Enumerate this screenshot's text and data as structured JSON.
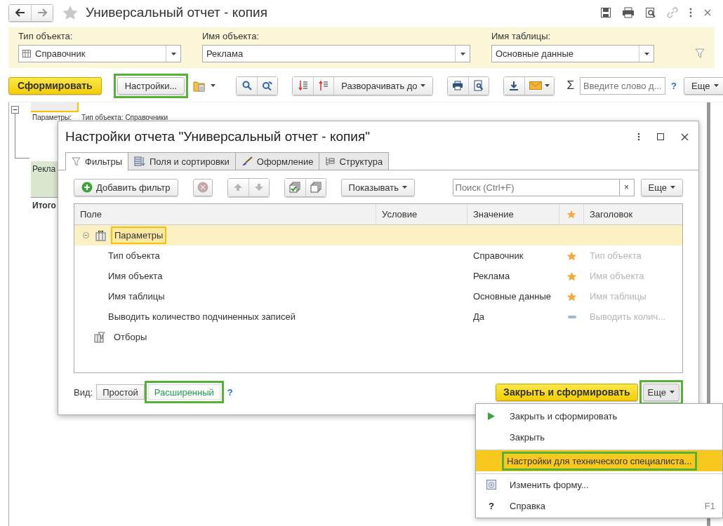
{
  "window": {
    "title": "Универсальный отчет - копия"
  },
  "params": [
    {
      "label": "Тип объекта:",
      "value": "Справочник",
      "kind": "type_select"
    },
    {
      "label": "Имя объекта:",
      "value": "Реклама",
      "kind": "select"
    },
    {
      "label": "Имя таблицы:",
      "value": "Основные данные",
      "kind": "select"
    }
  ],
  "toolbar": {
    "generate": "Сформировать",
    "settings": {
      "label": "Настройки...",
      "highlighted": true
    },
    "expand": "Разворачивать до",
    "sum": "Σ",
    "search_placeholder": "Введите слово д...",
    "help": "?",
    "more": "Еще"
  },
  "report": {
    "params_label": "Параметры:",
    "params_text": "Тип объекта: Справочники",
    "group_cell": "Рекла",
    "total": "Итого"
  },
  "dialog": {
    "title": "Настройки отчета \"Универсальный отчет - копия\"",
    "tabs": [
      {
        "label": "Фильтры",
        "selected": true
      },
      {
        "label": "Поля и сортировки",
        "selected": false
      },
      {
        "label": "Оформление",
        "selected": false
      },
      {
        "label": "Структура",
        "selected": false
      }
    ],
    "add_filter": "Добавить фильтр",
    "show": "Показывать",
    "search_placeholder": "Поиск (Ctrl+F)",
    "clear": "×",
    "more": "Еще",
    "columns": [
      "Поле",
      "Условие",
      "Значение",
      "Заголовок"
    ],
    "rows": [
      {
        "field": "Параметры",
        "kind": "group",
        "expanded": true,
        "selected": true,
        "children": [
          {
            "field": "Тип объекта",
            "value": "Справочник",
            "quick": true,
            "title": "Тип объекта"
          },
          {
            "field": "Имя объекта",
            "value": "Реклама",
            "quick": true,
            "title": "Имя объекта"
          },
          {
            "field": "Имя таблицы",
            "value": "Основные данные",
            "quick": true,
            "title": "Имя таблицы"
          },
          {
            "field": "Выводить количество подчиненных записей",
            "value": "Да",
            "quick": false,
            "title": "Выводить колич..."
          }
        ]
      },
      {
        "field": "Отборы",
        "kind": "filters",
        "selected": false
      }
    ],
    "view_label": "Вид:",
    "views": [
      {
        "label": "Простой",
        "selected": false,
        "highlighted": false
      },
      {
        "label": "Расширенный",
        "selected": true,
        "highlighted": true
      }
    ],
    "help": "?",
    "close_generate": "Закрыть и сформировать",
    "footer_more": {
      "label": "Еще",
      "highlighted": true
    }
  },
  "menu": [
    {
      "label": "Закрыть и сформировать",
      "kind": "run",
      "selected": false,
      "highlighted": false,
      "separator_before": false
    },
    {
      "label": "Закрыть",
      "kind": "plain",
      "selected": false,
      "highlighted": false,
      "separator_before": false
    },
    {
      "label": "Настройки для технического специалиста...",
      "kind": "plain",
      "selected": true,
      "highlighted": true,
      "separator_before": true
    },
    {
      "label": "Изменить форму...",
      "kind": "form",
      "selected": false,
      "highlighted": false,
      "separator_before": true
    },
    {
      "label": "Справка",
      "kind": "help",
      "glyph": "?",
      "shortcut": "F1",
      "selected": false,
      "highlighted": false,
      "separator_before": false
    }
  ]
}
